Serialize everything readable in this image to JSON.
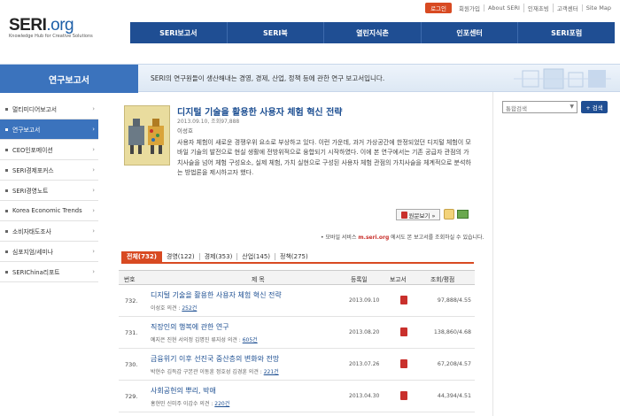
{
  "logo": {
    "main": "SERI",
    "org": ".org",
    "sub": "Knowledge Hub for Creative Solutions"
  },
  "topnav": {
    "login": "로그인",
    "links": [
      "회원가입",
      "About SERI",
      "인재초빙",
      "고객센터",
      "Site Map"
    ]
  },
  "mainnav": [
    "SERI보고서",
    "SERI북",
    "열린지식촌",
    "인포센터",
    "SERI포럼"
  ],
  "banner": {
    "label": "연구보고서",
    "desc": "SERI의 연구원들이 생산해내는 경영, 경제, 산업, 정책 등에 관한 연구 보고서입니다."
  },
  "sidebar": [
    {
      "label": "멀티미디어보고서",
      "active": false
    },
    {
      "label": "연구보고서",
      "active": true
    },
    {
      "label": "CEO인포메이션",
      "active": false
    },
    {
      "label": "SERI경제포커스",
      "active": false
    },
    {
      "label": "SERI경영노트",
      "active": false
    },
    {
      "label": "Korea Economic Trends",
      "active": false
    },
    {
      "label": "소비자태도조사",
      "active": false
    },
    {
      "label": "심포지엄/세미나",
      "active": false
    },
    {
      "label": "SERIChina리포트",
      "active": false
    }
  ],
  "featured": {
    "title": "디지털 기술을 활용한 사용자 체험 혁신 전략",
    "meta": "2013.09.10, 조회97,888",
    "author": "이성호",
    "summary": "사용자 체험이 새로운 경쟁우위 요소로 부상하고 있다. 이런 가운데, 과거 가상공간에 한정되었던 디지털 체험이 모바일 기술의 발전으로 현실 생활에 전방위적으로 융합되기 시작하였다. 이에 본 연구에서는 기존 공급자 관점의 가치사슬을 넘어 체험 구성요소, 실제 체험, 가치 실현으로 구성된 사용자 체험 관점의 가치사슬을 체계적으로 분석하는 방법론을 제시하고자 했다.",
    "view_button": "원문보기 »"
  },
  "mobile_note": {
    "prefix": "• 모바일 서비스",
    "link": "m.seri.org",
    "suffix": "에서도 본 보고서를 조회하실 수 있습니다."
  },
  "tabs": [
    "전체(732)",
    "경영(122)",
    "경제(353)",
    "산업(145)",
    "정책(275)"
  ],
  "table": {
    "headers": {
      "num": "번호",
      "title": "제 목",
      "date": "등록일",
      "report": "보고서",
      "stat": "조회/평점"
    },
    "rows": [
      {
        "num": "732.",
        "title": "디지털 기술을 활용한 사용자 체험 혁신 전략",
        "authors": "이성호 의견 : ",
        "comments": "252건",
        "date": "2013.09.10",
        "stat": "97,888/4.55"
      },
      {
        "num": "731.",
        "title": "직장인의 행복에 관한 연구",
        "authors": "예지은 진현 서의정 김명진 류지성 의견 : ",
        "comments": "605건",
        "date": "2013.08.20",
        "stat": "138,860/4.68"
      },
      {
        "num": "730.",
        "title": "금융위기 이후 선진국 중산층의 변화와 전망",
        "authors": "박현수 김득갑 구본관 이동훈 정호성 김경훈 의견 : ",
        "comments": "221건",
        "date": "2013.07.26",
        "stat": "67,208/4.57"
      },
      {
        "num": "729.",
        "title": "사회공헌의 뿌리, 박애",
        "authors": "홍현민 신미주 이갑수 의견 : ",
        "comments": "220건",
        "date": "2013.04.30",
        "stat": "44,394/4.51"
      }
    ]
  },
  "search": {
    "select_label": "통합검색",
    "button": "+ 검색"
  }
}
